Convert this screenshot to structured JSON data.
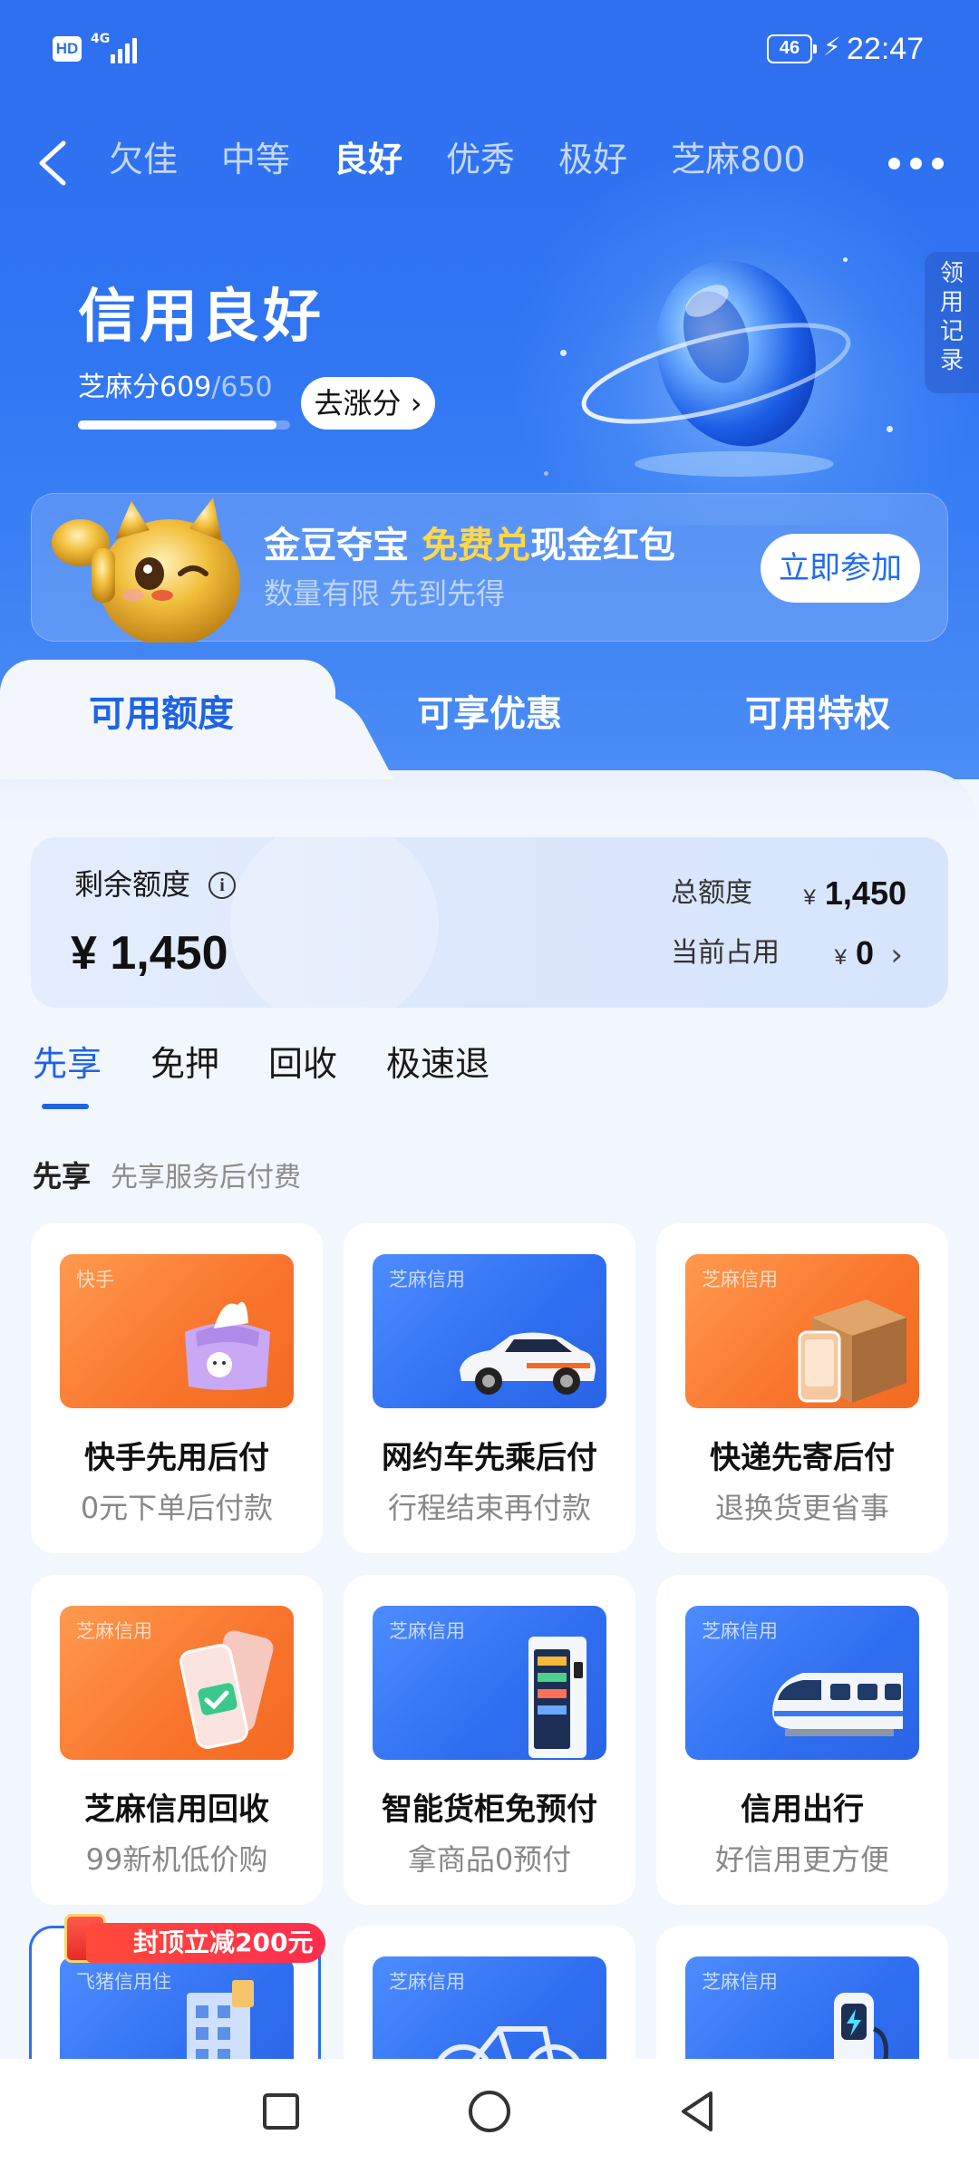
{
  "status_bar": {
    "hd": "HD",
    "network": "4G",
    "battery": "46",
    "time": "22:47"
  },
  "nav": {
    "level_tabs": [
      "欠佳",
      "中等",
      "良好",
      "优秀",
      "极好",
      "芝麻800"
    ],
    "active_tab": "良好"
  },
  "side_tab": {
    "label": "领用记录"
  },
  "credit": {
    "title": "信用良好",
    "score_prefix": "芝麻分",
    "score": "609",
    "score_total": "/650",
    "score_progress": 0.937,
    "raise_button": "去涨分"
  },
  "promo": {
    "title_part1": "金豆夺宝 ",
    "title_highlight": "免费兑",
    "title_part2": "现金红包",
    "subtitle": "数量有限 先到先得",
    "button": "立即参加"
  },
  "main_tabs": [
    "可用额度",
    "可享优惠",
    "可用特权"
  ],
  "quota": {
    "label": "剩余额度",
    "info_icon": "i",
    "remaining": "¥ 1,450",
    "total_label": "总额度",
    "total_value": "1,450",
    "used_label": "当前占用",
    "used_value": "0",
    "yen": "¥"
  },
  "sub_tabs": [
    "先享",
    "免押",
    "回收",
    "极速退"
  ],
  "section": {
    "title": "先享",
    "subtitle": "先享服务后付费"
  },
  "cards": [
    {
      "tag": "快手",
      "title": "快手先用后付",
      "sub": "0元下单后付款",
      "color": "orange",
      "icon": "tissue-pack-icon"
    },
    {
      "tag": "芝麻信用",
      "title": "网约车先乘后付",
      "sub": "行程结束再付款",
      "color": "blue",
      "icon": "car-icon"
    },
    {
      "tag": "芝麻信用",
      "title": "快递先寄后付",
      "sub": "退换货更省事",
      "color": "orange",
      "icon": "parcel-box-icon"
    },
    {
      "tag": "芝麻信用",
      "title": "芝麻信用回收",
      "sub": "99新机低价购",
      "color": "orange",
      "icon": "phone-icon"
    },
    {
      "tag": "芝麻信用",
      "title": "智能货柜免预付",
      "sub": "拿商品0预付",
      "color": "blue",
      "icon": "vending-machine-icon"
    },
    {
      "tag": "芝麻信用",
      "title": "信用出行",
      "sub": "好信用更方便",
      "color": "blue",
      "icon": "train-icon"
    },
    {
      "tag": "飞猪信用住",
      "title": "",
      "sub": "",
      "color": "blue",
      "icon": "hotel-building-icon",
      "badge": "封顶立减200元"
    },
    {
      "tag": "芝麻信用",
      "title": "",
      "sub": "",
      "color": "blue",
      "icon": "bicycle-icon"
    },
    {
      "tag": "芝麻信用",
      "title": "",
      "sub": "",
      "color": "blue",
      "icon": "ev-charger-icon"
    }
  ],
  "colors": {
    "brand_blue": "#2f6ff0",
    "active_text": "#1d63e6",
    "promo_highlight": "#ffd84a",
    "badge_red": "#ff2d4f"
  }
}
